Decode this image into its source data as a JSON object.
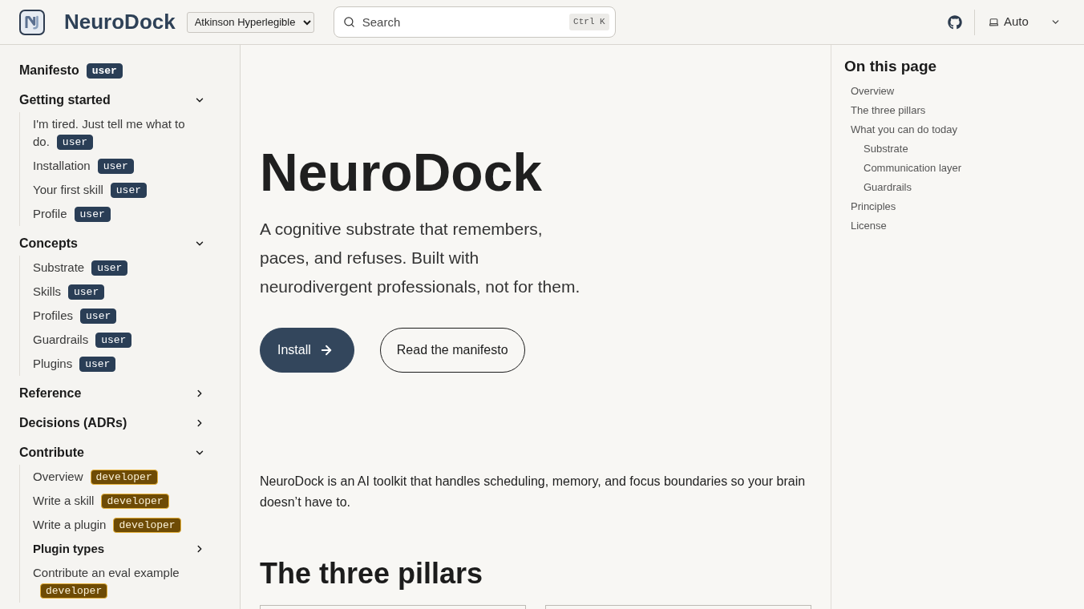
{
  "header": {
    "site_title": "NeuroDock",
    "font_select": {
      "value": "Atkinson Hyperlegible"
    },
    "search": {
      "placeholder": "Search",
      "shortcut": "Ctrl K"
    },
    "theme_select": {
      "value": "Auto"
    }
  },
  "sidebar": {
    "items": [
      {
        "kind": "link",
        "label": "Manifesto",
        "badge": {
          "label": "user",
          "kind": "user"
        }
      },
      {
        "kind": "group",
        "label": "Getting started",
        "expanded": true,
        "children": [
          {
            "kind": "link",
            "label": "I'm tired. Just tell me what to do.",
            "badge": {
              "label": "user",
              "kind": "user"
            }
          },
          {
            "kind": "link",
            "label": "Installation",
            "badge": {
              "label": "user",
              "kind": "user"
            }
          },
          {
            "kind": "link",
            "label": "Your first skill",
            "badge": {
              "label": "user",
              "kind": "user"
            }
          },
          {
            "kind": "link",
            "label": "Profile",
            "badge": {
              "label": "user",
              "kind": "user"
            }
          }
        ]
      },
      {
        "kind": "group",
        "label": "Concepts",
        "expanded": true,
        "children": [
          {
            "kind": "link",
            "label": "Substrate",
            "badge": {
              "label": "user",
              "kind": "user"
            }
          },
          {
            "kind": "link",
            "label": "Skills",
            "badge": {
              "label": "user",
              "kind": "user"
            }
          },
          {
            "kind": "link",
            "label": "Profiles",
            "badge": {
              "label": "user",
              "kind": "user"
            }
          },
          {
            "kind": "link",
            "label": "Guardrails",
            "badge": {
              "label": "user",
              "kind": "user"
            }
          },
          {
            "kind": "link",
            "label": "Plugins",
            "badge": {
              "label": "user",
              "kind": "user"
            }
          }
        ]
      },
      {
        "kind": "group",
        "label": "Reference",
        "expanded": false
      },
      {
        "kind": "group",
        "label": "Decisions (ADRs)",
        "expanded": false
      },
      {
        "kind": "group",
        "label": "Contribute",
        "expanded": true,
        "children": [
          {
            "kind": "link",
            "label": "Overview",
            "badge": {
              "label": "developer",
              "kind": "developer"
            }
          },
          {
            "kind": "link",
            "label": "Write a skill",
            "badge": {
              "label": "developer",
              "kind": "developer"
            }
          },
          {
            "kind": "link",
            "label": "Write a plugin",
            "badge": {
              "label": "developer",
              "kind": "developer"
            }
          },
          {
            "kind": "group",
            "label": "Plugin types",
            "expanded": false
          },
          {
            "kind": "link",
            "label": "Contribute an eval example",
            "badge": {
              "label": "developer",
              "kind": "developer"
            }
          }
        ]
      }
    ]
  },
  "main": {
    "title": "NeuroDock",
    "tagline": "A cognitive substrate that remembers, paces, and refuses. Built with neurodivergent professionals, not for them.",
    "actions": [
      {
        "label": "Install",
        "kind": "primary"
      },
      {
        "label": "Read the manifesto",
        "kind": "secondary"
      }
    ],
    "intro": "NeuroDock is an AI toolkit that handles scheduling, memory, and focus boundaries so your brain doesn’t have to.",
    "sections": [
      {
        "heading": "The three pillars"
      }
    ]
  },
  "toc": {
    "title": "On this page",
    "items": [
      {
        "label": "Overview"
      },
      {
        "label": "The three pillars"
      },
      {
        "label": "What you can do today",
        "children": [
          {
            "label": "Substrate"
          },
          {
            "label": "Communication layer"
          },
          {
            "label": "Guardrails"
          }
        ]
      },
      {
        "label": "Principles"
      },
      {
        "label": "License"
      }
    ]
  }
}
